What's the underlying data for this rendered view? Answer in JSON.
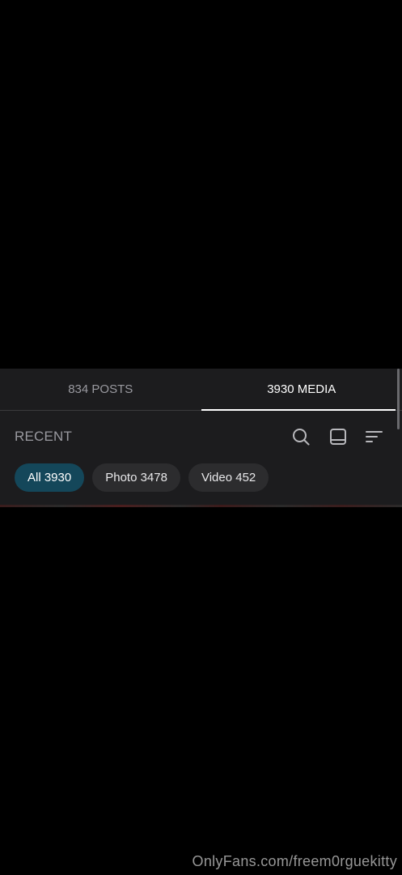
{
  "tabs": [
    {
      "label": "834 POSTS",
      "active": false
    },
    {
      "label": "3930 MEDIA",
      "active": true
    }
  ],
  "toolbar": {
    "title": "RECENT",
    "icons": [
      "search-icon",
      "layout-icon",
      "sort-icon"
    ]
  },
  "filters": [
    {
      "label": "All 3930",
      "active": true
    },
    {
      "label": "Photo 3478",
      "active": false
    },
    {
      "label": "Video 452",
      "active": false
    }
  ],
  "watermark": "OnlyFans.com/freem0rguekitty",
  "colors": {
    "panel_bg": "#1c1c1e",
    "active_chip": "#14475a",
    "chip_bg": "#2c2c2e",
    "muted_text": "#9a9aa0"
  }
}
